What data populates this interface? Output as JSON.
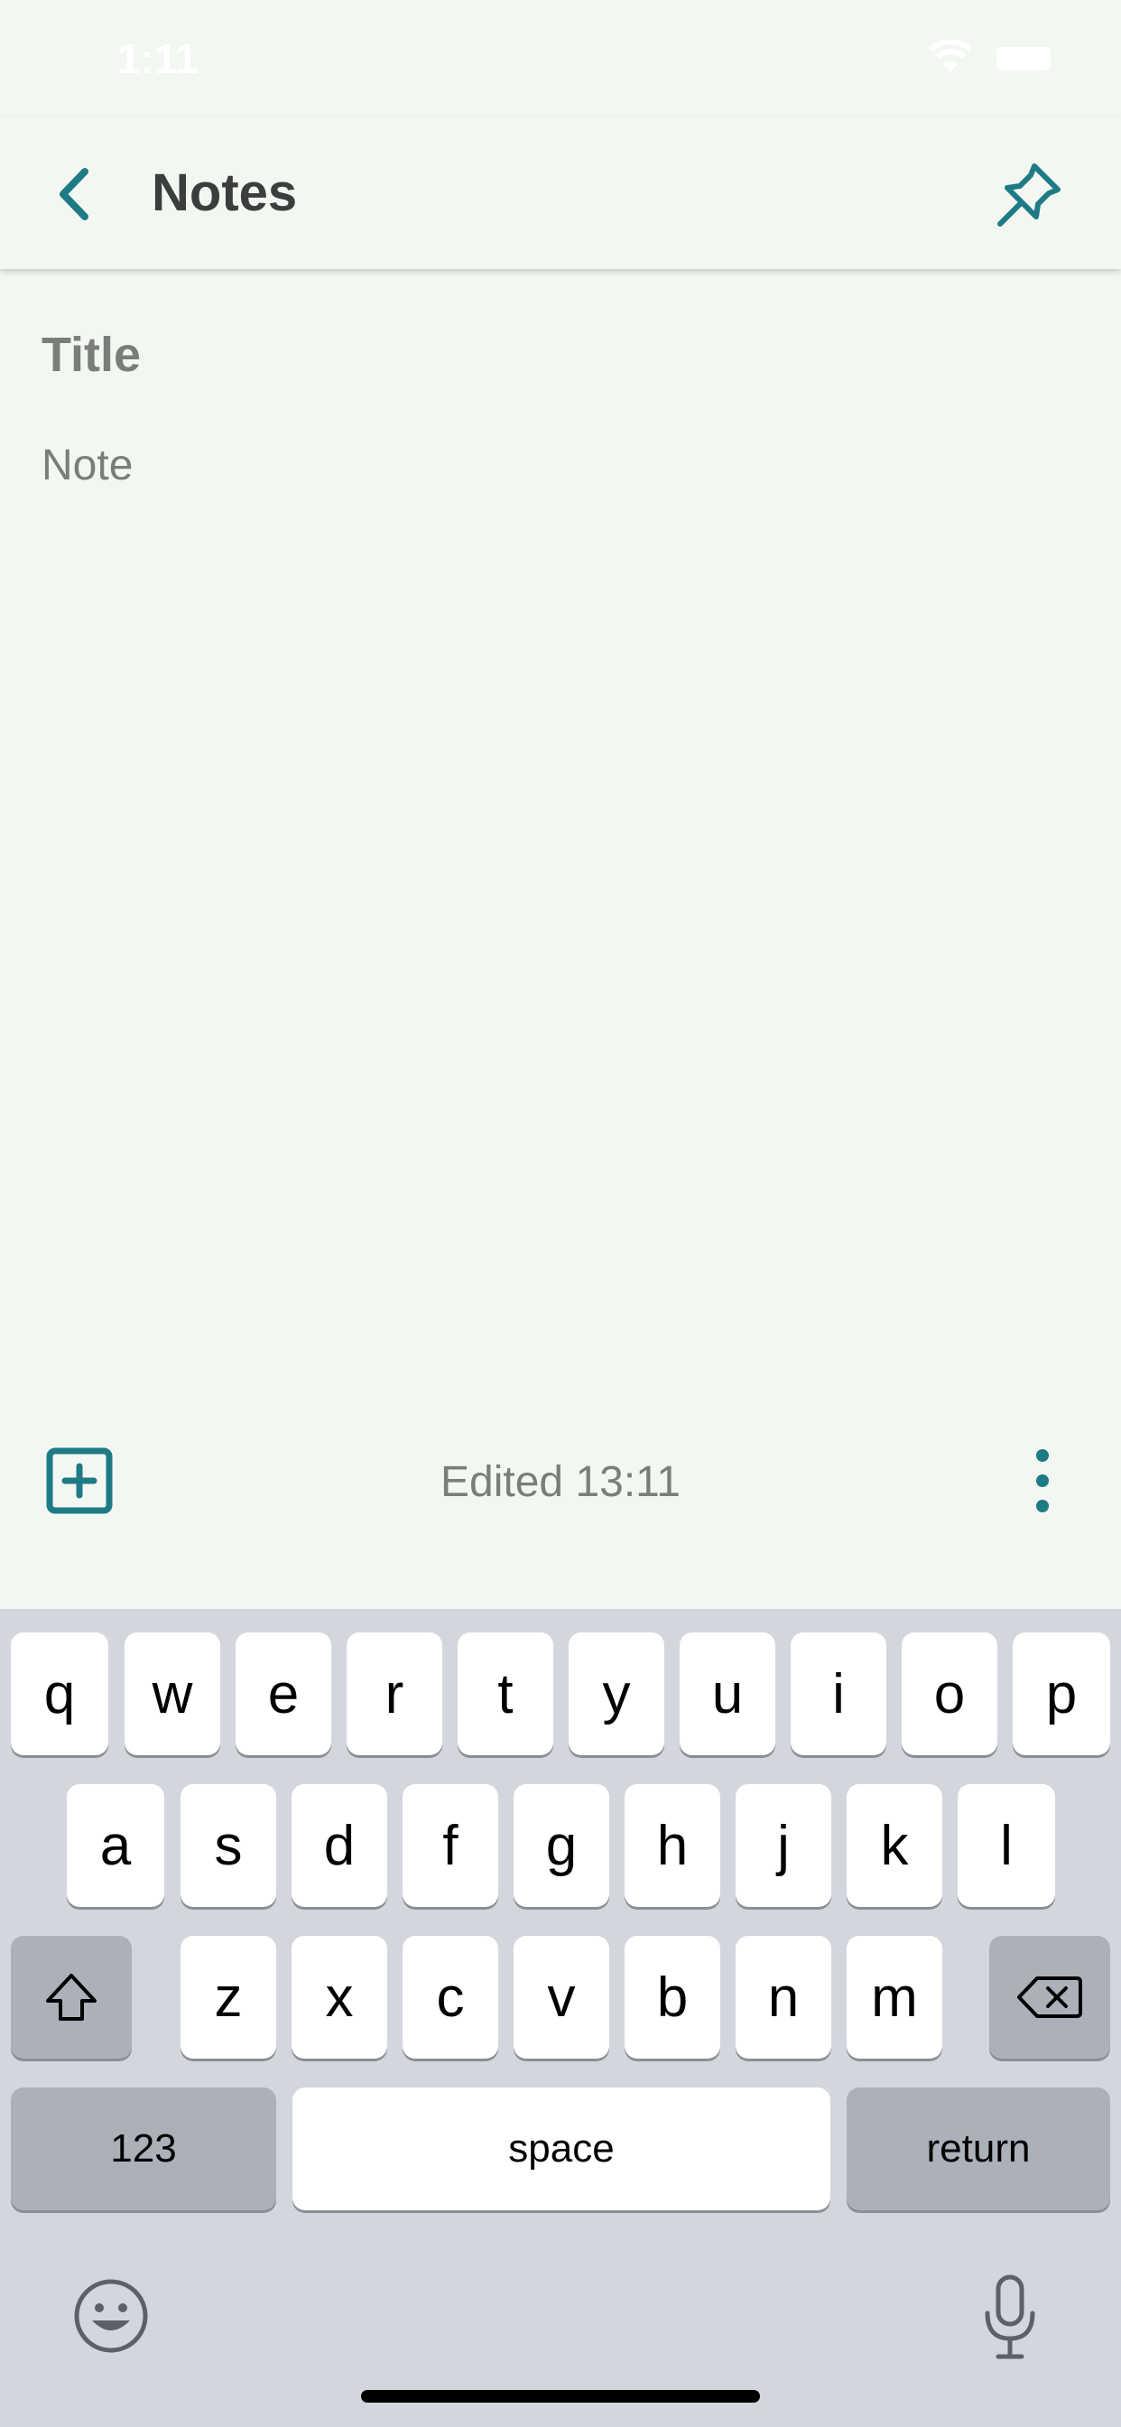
{
  "status_bar": {
    "time": "1:11"
  },
  "app_bar": {
    "title": "Notes"
  },
  "editor": {
    "title_placeholder": "Title",
    "note_placeholder": "Note"
  },
  "bottom_bar": {
    "edited_text": "Edited 13:11"
  },
  "keyboard": {
    "row1": [
      "q",
      "w",
      "e",
      "r",
      "t",
      "y",
      "u",
      "i",
      "o",
      "p"
    ],
    "row2": [
      "a",
      "s",
      "d",
      "f",
      "g",
      "h",
      "j",
      "k",
      "l"
    ],
    "row3": [
      "z",
      "x",
      "c",
      "v",
      "b",
      "n",
      "m"
    ],
    "numbers_label": "123",
    "space_label": "space",
    "return_label": "return"
  },
  "colors": {
    "accent": "#1e7b85",
    "background": "#f3f7f2",
    "keyboard_bg": "#d3d6dc"
  }
}
